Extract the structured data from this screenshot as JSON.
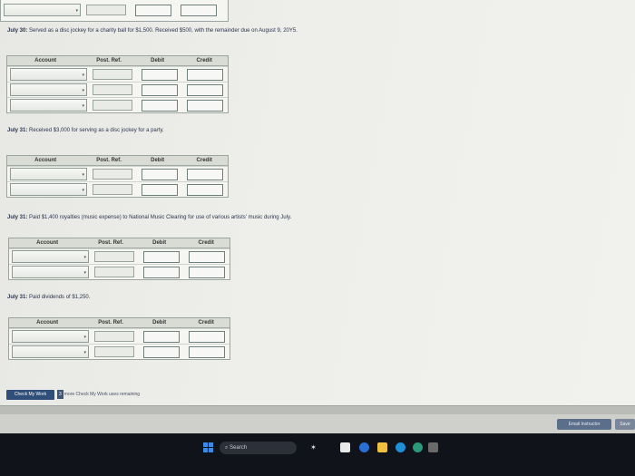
{
  "entries": [
    {
      "date": "July 30:",
      "text": "Served as a disc jockey for a charity ball for $1,500. Received $500, with the remainder due on August 9, 20Y5.",
      "rows": 3
    },
    {
      "date": "July 31:",
      "text": "Received $3,000 for serving as a disc jockey for a party.",
      "rows": 2
    },
    {
      "date": "July 31:",
      "text": "Paid $1,400 royalties (music expense) to National Music Clearing for use of various artists' music during July.",
      "rows": 2
    },
    {
      "date": "July 31:",
      "text": "Paid dividends of $1,250.",
      "rows": 2
    }
  ],
  "table_headers": {
    "account": "Account",
    "post_ref": "Post. Ref.",
    "debit": "Debit",
    "credit": "Credit"
  },
  "footer": {
    "check_my_work": "Check My Work",
    "remaining_count": "3",
    "remaining_text": "more Check My Work uses remaining",
    "email_instructor": "Email Instructor",
    "save": "Save"
  },
  "taskbar": {
    "search_placeholder": "Search"
  }
}
